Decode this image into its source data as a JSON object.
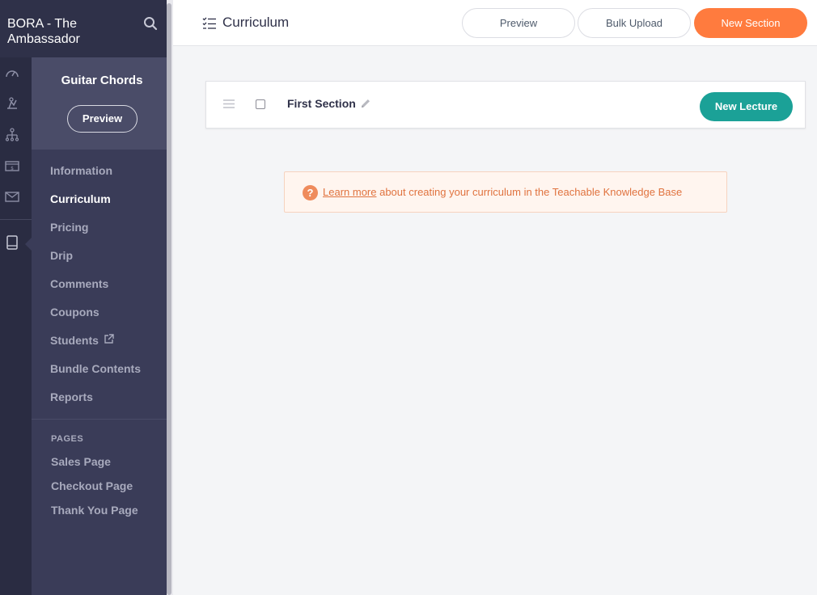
{
  "school": {
    "name": "BORA - The Ambassador"
  },
  "rail": {
    "icons": [
      "dashboard-icon",
      "marketing-icon",
      "sitemap-icon",
      "sales-icon",
      "email-icon",
      "courses-icon"
    ]
  },
  "course": {
    "title": "Guitar Chords",
    "preview_label": "Preview"
  },
  "nav": {
    "items": [
      {
        "label": "Information",
        "active": false
      },
      {
        "label": "Curriculum",
        "active": true
      },
      {
        "label": "Pricing",
        "active": false
      },
      {
        "label": "Drip",
        "active": false
      },
      {
        "label": "Comments",
        "active": false
      },
      {
        "label": "Coupons",
        "active": false
      },
      {
        "label": "Students",
        "active": false,
        "external": true
      },
      {
        "label": "Bundle Contents",
        "active": false
      },
      {
        "label": "Reports",
        "active": false
      }
    ],
    "pages_label": "PAGES",
    "pages": [
      "Sales Page",
      "Checkout Page",
      "Thank You Page"
    ]
  },
  "header": {
    "title": "Curriculum",
    "preview_label": "Preview",
    "bulk_upload_label": "Bulk Upload",
    "new_section_label": "New Section"
  },
  "section": {
    "name": "First Section",
    "new_lecture_label": "New Lecture"
  },
  "banner": {
    "link_text": "Learn more",
    "text": " about creating your curriculum in the Teachable Knowledge Base",
    "help_glyph": "?"
  },
  "colors": {
    "sidebar": "#2f3149",
    "accent_orange": "#ff7b3e",
    "accent_teal": "#1ba197",
    "banner_text": "#e0733f"
  }
}
